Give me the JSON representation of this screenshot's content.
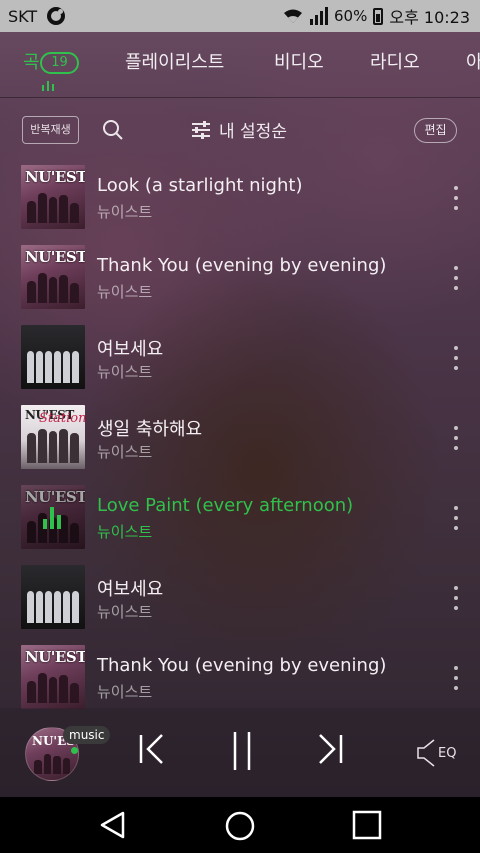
{
  "status_bar": {
    "carrier": "SKT",
    "battery_percent": "60",
    "time": "오후 10:23"
  },
  "tabs": {
    "items": [
      {
        "label": "곡",
        "active": true
      },
      {
        "label": "플레이리스트"
      },
      {
        "label": "비디오"
      },
      {
        "label": "라디오"
      },
      {
        "label": "아"
      }
    ],
    "song_count": "19"
  },
  "toolbar": {
    "repeat_label": "반복재생",
    "sort_label": "내 설정순",
    "edit_label": "편집"
  },
  "songs": [
    {
      "title": "Look (a starlight night)",
      "artist": "뉴이스트",
      "album_text": "NU'EST",
      "playing": false
    },
    {
      "title": "Thank You (evening by evening)",
      "artist": "뉴이스트",
      "album_text": "NU'EST",
      "playing": false
    },
    {
      "title": "여보세요",
      "artist": "뉴이스트",
      "playing": false
    },
    {
      "title": "생일 축하해요",
      "artist": "뉴이스트",
      "album_text": "NU'EST",
      "album_subtext": "Station",
      "playing": false
    },
    {
      "title": "Love Paint (every afternoon)",
      "artist": "뉴이스트",
      "album_text": "NU'EST",
      "playing": true
    },
    {
      "title": "여보세요",
      "artist": "뉴이스트",
      "playing": false
    },
    {
      "title": "Thank You (evening by evening)",
      "artist": "뉴이스트",
      "album_text": "NU'EST",
      "playing": false
    }
  ],
  "player": {
    "album_text": "NU'EST",
    "source_badge": "music",
    "eq_label": "EQ"
  },
  "colors": {
    "accent": "#2fc14b",
    "status_bar_bg": "#bdbdbd"
  }
}
